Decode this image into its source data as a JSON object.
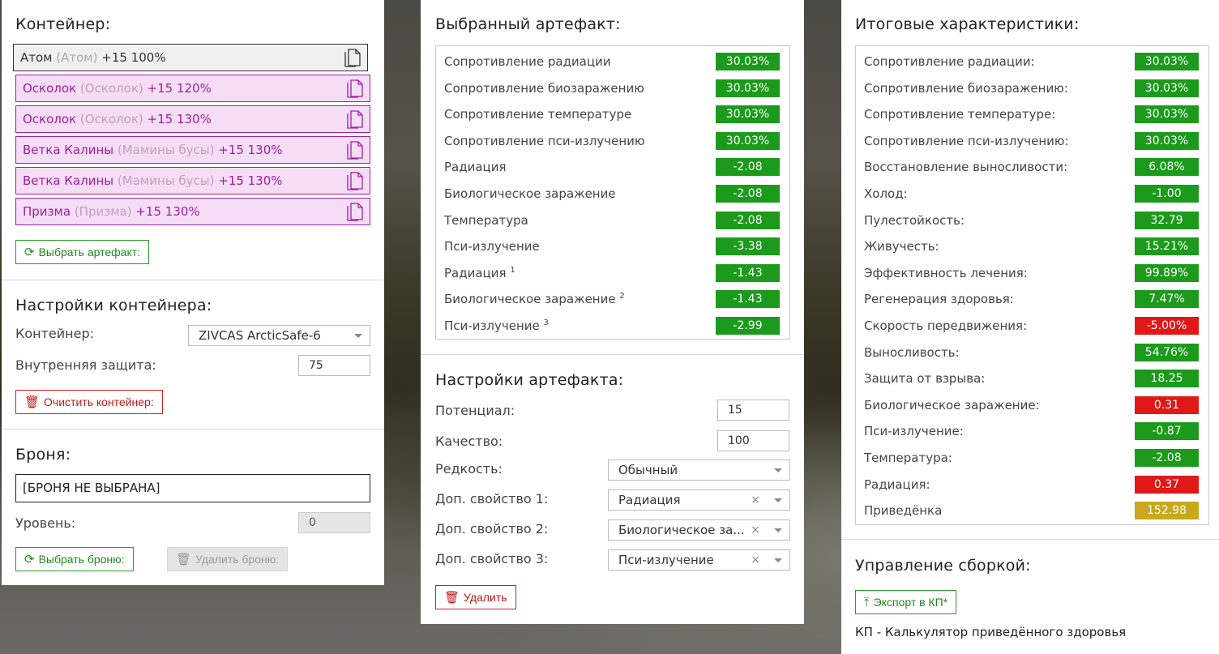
{
  "container_panel": {
    "title": "Контейнер:",
    "slots": [
      {
        "name": "Атом",
        "alias": "(Атом)",
        "tail": "+15 100%"
      },
      {
        "name": "Осколок",
        "alias": "(Осколок)",
        "tail": "+15 120%"
      },
      {
        "name": "Осколок",
        "alias": "(Осколок)",
        "tail": "+15 130%"
      },
      {
        "name": "Ветка Калины",
        "alias": "(Мамины бусы)",
        "tail": "+15 130%"
      },
      {
        "name": "Ветка Калины",
        "alias": "(Мамины бусы)",
        "tail": "+15 130%"
      },
      {
        "name": "Призма",
        "alias": "(Призма)",
        "tail": "+15 130%"
      }
    ],
    "select_artifact": "Выбрать артефакт:",
    "settings_title": "Настройки контейнера:",
    "container_label": "Контейнер:",
    "container_value": "ZIVCAS ArcticSafe-6",
    "inner_protection_label": "Внутренняя защита:",
    "inner_protection_value": "75",
    "clear_button": "Очистить контейнер:",
    "armor_title": "Броня:",
    "armor_value": "[БРОНЯ НЕ ВЫБРАНА]",
    "level_label": "Уровень:",
    "level_value": "0",
    "select_armor": "Выбрать броню:",
    "delete_armor": "Удалить броню:"
  },
  "artifact_panel": {
    "title": "Выбранный артефакт:",
    "stats": [
      {
        "label": "Сопротивление радиации",
        "sup": "",
        "value": "30.03%",
        "color": "g"
      },
      {
        "label": "Сопротивление биозаражению",
        "sup": "",
        "value": "30.03%",
        "color": "g"
      },
      {
        "label": "Сопротивление температуре",
        "sup": "",
        "value": "30.03%",
        "color": "g"
      },
      {
        "label": "Сопротивление пси-излучению",
        "sup": "",
        "value": "30.03%",
        "color": "g"
      },
      {
        "label": "Радиация",
        "sup": "",
        "value": "-2.08",
        "color": "g"
      },
      {
        "label": "Биологическое заражение",
        "sup": "",
        "value": "-2.08",
        "color": "g"
      },
      {
        "label": "Температура",
        "sup": "",
        "value": "-2.08",
        "color": "g"
      },
      {
        "label": "Пси-излучение",
        "sup": "",
        "value": "-3.38",
        "color": "g"
      },
      {
        "label": "Радиация",
        "sup": "1",
        "value": "-1.43",
        "color": "g"
      },
      {
        "label": "Биологическое заражение",
        "sup": "2",
        "value": "-1.43",
        "color": "g"
      },
      {
        "label": "Пси-излучение",
        "sup": "3",
        "value": "-2.99",
        "color": "g"
      }
    ],
    "settings_title": "Настройки артефакта:",
    "potential_label": "Потенциал:",
    "potential_value": "15",
    "quality_label": "Качество:",
    "quality_value": "100",
    "rarity_label": "Редкость:",
    "rarity_value": "Обычный",
    "extra1_label": "Доп. свойство 1:",
    "extra1_value": "Радиация",
    "extra2_label": "Доп. свойство 2:",
    "extra2_value": "Биологическое за...",
    "extra3_label": "Доп. свойство 3:",
    "extra3_value": "Пси-излучение",
    "clear_glyph": "×",
    "delete_button": "Удалить"
  },
  "totals_panel": {
    "title": "Итоговые характеристики:",
    "stats": [
      {
        "label": "Сопротивление радиации:",
        "value": "30.03%",
        "color": "g"
      },
      {
        "label": "Сопротивление биозаражению:",
        "value": "30.03%",
        "color": "g"
      },
      {
        "label": "Сопротивление температуре:",
        "value": "30.03%",
        "color": "g"
      },
      {
        "label": "Сопротивление пси-излучению:",
        "value": "30.03%",
        "color": "g"
      },
      {
        "label": "Восстановление выносливости:",
        "value": "6.08%",
        "color": "g"
      },
      {
        "label": "Холод:",
        "value": "-1.00",
        "color": "g"
      },
      {
        "label": "Пулестойкость:",
        "value": "32.79",
        "color": "g"
      },
      {
        "label": "Живучесть:",
        "value": "15.21%",
        "color": "g"
      },
      {
        "label": "Эффективность лечения:",
        "value": "99.89%",
        "color": "g"
      },
      {
        "label": "Регенерация здоровья:",
        "value": "7.47%",
        "color": "g"
      },
      {
        "label": "Скорость передвижения:",
        "value": "-5.00%",
        "color": "r"
      },
      {
        "label": "Выносливость:",
        "value": "54.76%",
        "color": "g"
      },
      {
        "label": "Защита от взрыва:",
        "value": "18.25",
        "color": "g"
      },
      {
        "label": "Биологическое заражение:",
        "value": "0.31",
        "color": "r"
      },
      {
        "label": "Пси-излучение:",
        "value": "-0.87",
        "color": "g"
      },
      {
        "label": "Температура:",
        "value": "-2.08",
        "color": "g"
      },
      {
        "label": "Радиация:",
        "value": "0.37",
        "color": "r"
      },
      {
        "label": "Приведёнка",
        "value": "152.98",
        "color": "y"
      }
    ],
    "build_title": "Управление сборкой:",
    "export_button": "Экспорт в КП*",
    "footnote": "КП - Калькулятор приведённого здоровья"
  }
}
